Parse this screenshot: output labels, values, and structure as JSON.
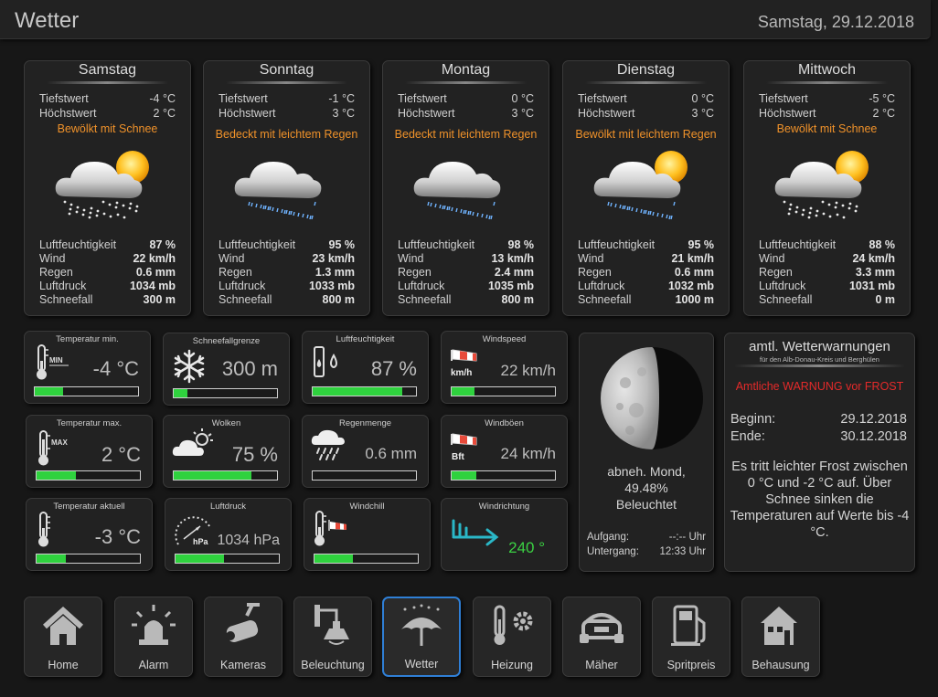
{
  "header": {
    "title": "Wetter",
    "date": "Samstag, 29.12.2018"
  },
  "forecast": [
    {
      "day": "Samstag",
      "tief_label": "Tiefstwert",
      "tief": "-4 °C",
      "hoch_label": "Höchstwert",
      "hoch": "2 °C",
      "condition": "Bewölkt mit Schnee",
      "icon": "cloud-sun-snow-icon",
      "humidity_label": "Luftfeuchtigkeit",
      "humidity": "87 %",
      "wind_label": "Wind",
      "wind": "22 km/h",
      "rain_label": "Regen",
      "rain": "0.6 mm",
      "pressure_label": "Luftdruck",
      "pressure": "1034 mb",
      "snow_label": "Schneefall",
      "snow": "300 m"
    },
    {
      "day": "Sonntag",
      "tief_label": "Tiefstwert",
      "tief": "-1 °C",
      "hoch_label": "Höchstwert",
      "hoch": "3 °C",
      "condition": "Bedeckt mit leichtem Regen",
      "icon": "cloud-rain-icon",
      "humidity_label": "Luftfeuchtigkeit",
      "humidity": "95 %",
      "wind_label": "Wind",
      "wind": "23 km/h",
      "rain_label": "Regen",
      "rain": "1.3 mm",
      "pressure_label": "Luftdruck",
      "pressure": "1033 mb",
      "snow_label": "Schneefall",
      "snow": "800 m"
    },
    {
      "day": "Montag",
      "tief_label": "Tiefstwert",
      "tief": "0 °C",
      "hoch_label": "Höchstwert",
      "hoch": "3 °C",
      "condition": "Bedeckt mit leichtem Regen",
      "icon": "cloud-rain-icon",
      "humidity_label": "Luftfeuchtigkeit",
      "humidity": "98 %",
      "wind_label": "Wind",
      "wind": "13 km/h",
      "rain_label": "Regen",
      "rain": "2.4 mm",
      "pressure_label": "Luftdruck",
      "pressure": "1035 mb",
      "snow_label": "Schneefall",
      "snow": "800 m"
    },
    {
      "day": "Dienstag",
      "tief_label": "Tiefstwert",
      "tief": "0 °C",
      "hoch_label": "Höchstwert",
      "hoch": "3 °C",
      "condition": "Bewölkt mit leichtem Regen",
      "icon": "cloud-sun-rain-icon",
      "humidity_label": "Luftfeuchtigkeit",
      "humidity": "95 %",
      "wind_label": "Wind",
      "wind": "21 km/h",
      "rain_label": "Regen",
      "rain": "0.6 mm",
      "pressure_label": "Luftdruck",
      "pressure": "1032 mb",
      "snow_label": "Schneefall",
      "snow": "1000 m"
    },
    {
      "day": "Mittwoch",
      "tief_label": "Tiefstwert",
      "tief": "-5 °C",
      "hoch_label": "Höchstwert",
      "hoch": "2 °C",
      "condition": "Bewölkt mit Schnee",
      "icon": "cloud-sun-snow-icon",
      "humidity_label": "Luftfeuchtigkeit",
      "humidity": "88 %",
      "wind_label": "Wind",
      "wind": "24 km/h",
      "rain_label": "Regen",
      "rain": "3.3 mm",
      "pressure_label": "Luftdruck",
      "pressure": "1031 mb",
      "snow_label": "Schneefall",
      "snow": "0 m"
    }
  ],
  "tiles": {
    "temp_min": {
      "title": "Temperatur min.",
      "value": "-4 °C",
      "level": 0.27,
      "icon": "thermometer-min-icon",
      "badge": "MIN"
    },
    "schneefall": {
      "title": "Schneefallgrenze",
      "value": "300 m",
      "level": 0.13,
      "icon": "snowflake-icon"
    },
    "feuchte": {
      "title": "Luftfeuchtigkeit",
      "value": "87 %",
      "level": 0.87,
      "icon": "humidity-icon"
    },
    "windspeed": {
      "title": "Windspeed",
      "value": "22 km/h",
      "level": 0.22,
      "icon": "windsock-icon",
      "badge": "km/h"
    },
    "temp_max": {
      "title": "Temperatur max.",
      "value": "2 °C",
      "level": 0.38,
      "icon": "thermometer-max-icon",
      "badge": "MAX"
    },
    "wolken": {
      "title": "Wolken",
      "value": "75 %",
      "level": 0.75,
      "icon": "cloud-sun-icon"
    },
    "regen": {
      "title": "Regenmenge",
      "value": "0.6 mm",
      "level": 0.0,
      "icon": "cloud-rain-icon"
    },
    "windboeen": {
      "title": "Windböen",
      "value": "24 km/h",
      "level": 0.24,
      "icon": "windsock-icon",
      "badge": "Bft"
    },
    "temp_akt": {
      "title": "Temperatur aktuell",
      "value": "-3 °C",
      "level": 0.28,
      "icon": "thermometer-icon"
    },
    "luftdruck": {
      "title": "Luftdruck",
      "value": "1034 hPa",
      "level": 0.47,
      "icon": "barometer-icon",
      "badge": "hPa"
    },
    "windchill": {
      "title": "Windchill",
      "value": "",
      "level": 0.37,
      "icon": "thermometer-wind-icon"
    },
    "windrichtung": {
      "title": "Windrichtung",
      "value": "240 °",
      "icon": "wind-arrow-icon"
    }
  },
  "moon": {
    "phase": "abneh. Mond,",
    "percent": "49.48%",
    "lit": "Beleuchtet",
    "rise_label": "Aufgang:",
    "rise": "--:-- Uhr",
    "set_label": "Untergang:",
    "set": "12:33 Uhr"
  },
  "warning": {
    "title": "amtl. Wetterwarnungen",
    "region": "für den Alb-Donau-Kreis und Berghülen",
    "headline": "Amtliche WARNUNG vor FROST",
    "begin_label": "Beginn:",
    "begin": "29.12.2018",
    "end_label": "Ende:",
    "end": "30.12.2018",
    "text": "Es tritt leichter Frost zwischen 0 °C und -2 °C auf. Über Schnee sinken die Temperaturen auf Werte bis -4 °C."
  },
  "nav": [
    {
      "label": "Home",
      "icon": "house-icon"
    },
    {
      "label": "Alarm",
      "icon": "siren-icon"
    },
    {
      "label": "Kameras",
      "icon": "camera-icon"
    },
    {
      "label": "Beleuchtung",
      "icon": "lamp-icon"
    },
    {
      "label": "Wetter",
      "icon": "umbrella-icon",
      "active": true
    },
    {
      "label": "Heizung",
      "icon": "thermometer-gear-icon"
    },
    {
      "label": "Mäher",
      "icon": "mower-icon"
    },
    {
      "label": "Spritpreis",
      "icon": "fuel-pump-icon"
    },
    {
      "label": "Behausung",
      "icon": "building-icon"
    }
  ],
  "colors": {
    "accent_orange": "#f0922a",
    "warn_red": "#e52a2a",
    "bar_green": "#2fd23e",
    "active_blue": "#2f7fd6"
  }
}
